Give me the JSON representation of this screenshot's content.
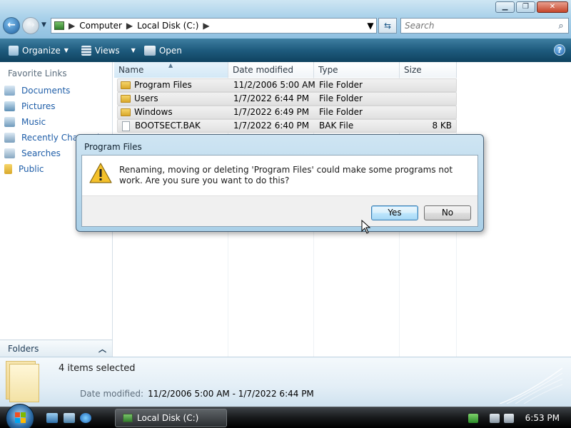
{
  "window": {
    "controls": [
      "minimize",
      "maximize",
      "close"
    ]
  },
  "address": {
    "crumbs": [
      "Computer",
      "Local Disk (C:)"
    ]
  },
  "search": {
    "placeholder": "Search"
  },
  "commands": {
    "organize": "Organize",
    "views": "Views",
    "open": "Open"
  },
  "nav": {
    "heading": "Favorite Links",
    "links": [
      "Documents",
      "Pictures",
      "Music",
      "Recently Changed",
      "Searches",
      "Public"
    ],
    "folders_label": "Folders"
  },
  "columns": {
    "name": "Name",
    "date": "Date modified",
    "type": "Type",
    "size": "Size"
  },
  "files": [
    {
      "name": "Program Files",
      "date": "11/2/2006 5:00 AM",
      "type": "File Folder",
      "size": ""
    },
    {
      "name": "Users",
      "date": "1/7/2022 6:44 PM",
      "type": "File Folder",
      "size": ""
    },
    {
      "name": "Windows",
      "date": "1/7/2022 6:49 PM",
      "type": "File Folder",
      "size": ""
    },
    {
      "name": "BOOTSECT.BAK",
      "date": "1/7/2022 6:40 PM",
      "type": "BAK File",
      "size": "8 KB"
    }
  ],
  "details": {
    "selection": "4 items selected",
    "date_label": "Date modified:",
    "date_range": "11/2/2006 5:00 AM - 1/7/2022 6:44 PM"
  },
  "dialog": {
    "title": "Program Files",
    "message": "Renaming, moving or deleting 'Program Files' could make some programs not work. Are you sure you want to do this?",
    "yes": "Yes",
    "no": "No",
    "icon": "warning-icon"
  },
  "taskbar": {
    "task": "Local Disk (C:)",
    "clock": "6:53 PM"
  },
  "colors": {
    "accent": "#1e5b7e",
    "link": "#1f5ea8"
  }
}
